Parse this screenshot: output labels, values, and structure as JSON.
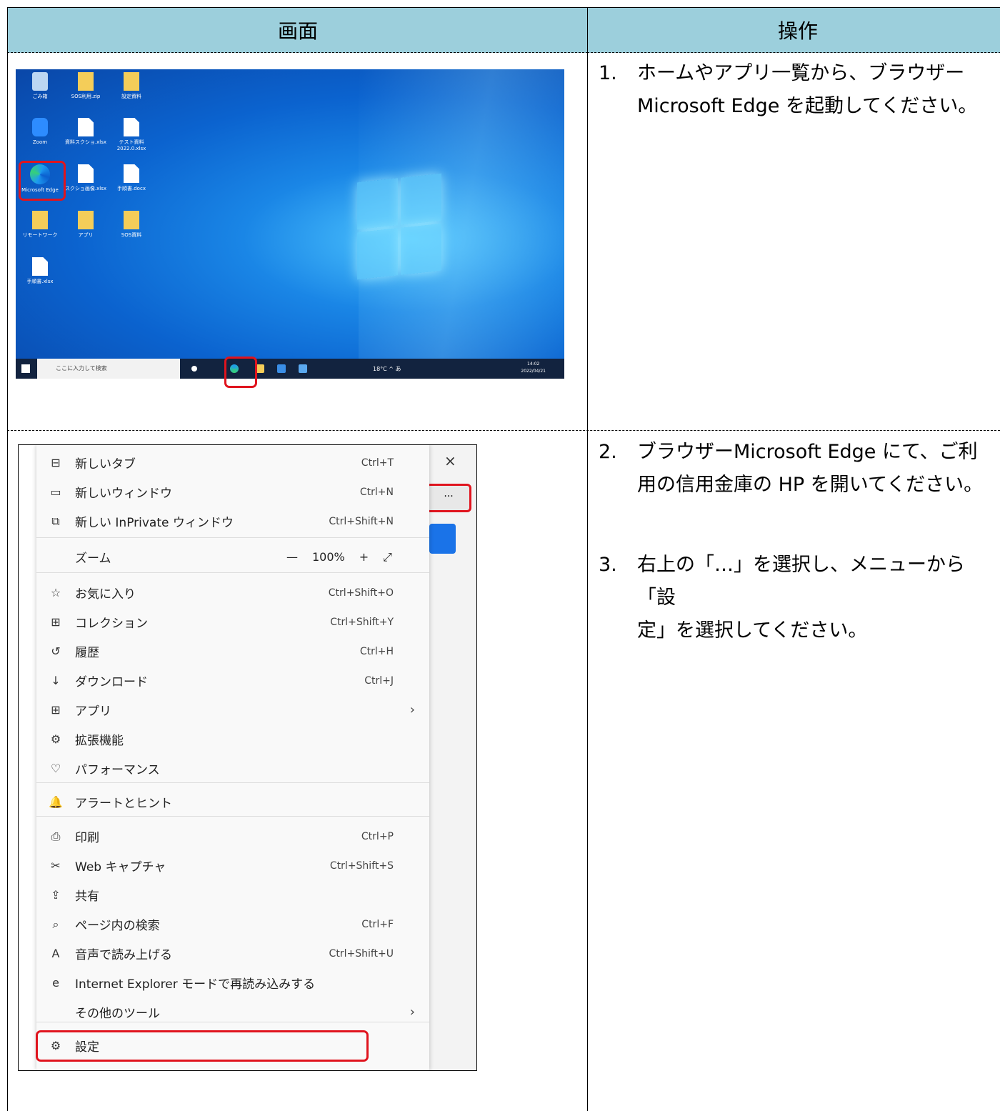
{
  "header": {
    "left": "画面",
    "right": "操作"
  },
  "steps": [
    {
      "num": "1.",
      "lines": [
        "ホームやアプリ一覧から、ブラウザー",
        "Microsoft Edge を起動してください。"
      ]
    },
    {
      "num": "2.",
      "lines": [
        "ブラウザーMicrosoft Edge にて、ご利",
        "用の信用金庫の HP を開いてください。"
      ]
    },
    {
      "num": "3.",
      "lines": [
        "右上の「…」を選択し、メニューから「設",
        "定」を選択してください。"
      ]
    }
  ],
  "desktop": {
    "icons": [
      {
        "label": "ごみ箱",
        "type": "bin"
      },
      {
        "label": "SOS利用.zip",
        "type": "folder"
      },
      {
        "label": "設定資料",
        "type": "folder"
      },
      {
        "label": "Zoom",
        "type": "zoom"
      },
      {
        "label": "資料スクショ.xlsx",
        "type": "doc"
      },
      {
        "label": "テスト資料 2022.0.xlsx",
        "type": "doc"
      },
      {
        "label": "Microsoft Edge",
        "type": "edge"
      },
      {
        "label": "スクショ画像.xlsx",
        "type": "doc"
      },
      {
        "label": "手順書.docx",
        "type": "doc"
      },
      {
        "label": "リモートワーク",
        "type": "folder"
      },
      {
        "label": "アプリ",
        "type": "folder"
      },
      {
        "label": "SOS資料",
        "type": "folder"
      },
      {
        "label": "手順書.xlsx",
        "type": "doc"
      }
    ],
    "taskbar_search": "ここに入力して検索",
    "tray": "18°C ^ あ",
    "clock_time": "14:02",
    "clock_date": "2022/04/21"
  },
  "browser": {
    "close": "×",
    "more": "···",
    "zoom_value": "100%",
    "zoom_minus": "—",
    "zoom_plus": "+",
    "zoom_expand": "⤢",
    "menu": [
      {
        "icon": "new-tab-icon",
        "glyph": "⊟",
        "label": "新しいタブ",
        "shortcut": "Ctrl+T"
      },
      {
        "icon": "new-window-icon",
        "glyph": "▭",
        "label": "新しいウィンドウ",
        "shortcut": "Ctrl+N"
      },
      {
        "icon": "inprivate-icon",
        "glyph": "⧉",
        "label": "新しい InPrivate ウィンドウ",
        "shortcut": "Ctrl+Shift+N"
      },
      {
        "icon": "",
        "glyph": "",
        "label": "ズーム",
        "shortcut": ""
      },
      {
        "icon": "favorites-icon",
        "glyph": "☆",
        "label": "お気に入り",
        "shortcut": "Ctrl+Shift+O"
      },
      {
        "icon": "collections-icon",
        "glyph": "⊞",
        "label": "コレクション",
        "shortcut": "Ctrl+Shift+Y"
      },
      {
        "icon": "history-icon",
        "glyph": "↺",
        "label": "履歴",
        "shortcut": "Ctrl+H"
      },
      {
        "icon": "download-icon",
        "glyph": "↓",
        "label": "ダウンロード",
        "shortcut": "Ctrl+J"
      },
      {
        "icon": "apps-icon",
        "glyph": "⊞",
        "label": "アプリ",
        "shortcut": "",
        "arrow": "›"
      },
      {
        "icon": "extensions-icon",
        "glyph": "⚙",
        "label": "拡張機能",
        "shortcut": ""
      },
      {
        "icon": "performance-icon",
        "glyph": "♡",
        "label": "パフォーマンス",
        "shortcut": ""
      },
      {
        "icon": "alerts-icon",
        "glyph": "🔔",
        "label": "アラートとヒント",
        "shortcut": ""
      },
      {
        "icon": "print-icon",
        "glyph": "⎙",
        "label": "印刷",
        "shortcut": "Ctrl+P"
      },
      {
        "icon": "web-capture-icon",
        "glyph": "✂",
        "label": "Web キャプチャ",
        "shortcut": "Ctrl+Shift+S"
      },
      {
        "icon": "share-icon",
        "glyph": "⇪",
        "label": "共有",
        "shortcut": ""
      },
      {
        "icon": "find-icon",
        "glyph": "⌕",
        "label": "ページ内の検索",
        "shortcut": "Ctrl+F"
      },
      {
        "icon": "read-aloud-icon",
        "glyph": "A",
        "label": "音声で読み上げる",
        "shortcut": "Ctrl+Shift+U"
      },
      {
        "icon": "ie-mode-icon",
        "glyph": "e",
        "label": "Internet Explorer モードで再読み込みする",
        "shortcut": ""
      },
      {
        "icon": "",
        "glyph": "",
        "label": "その他のツール",
        "shortcut": "",
        "arrow": "›"
      },
      {
        "icon": "settings-icon",
        "glyph": "⚙",
        "label": "設定",
        "shortcut": ""
      }
    ]
  }
}
